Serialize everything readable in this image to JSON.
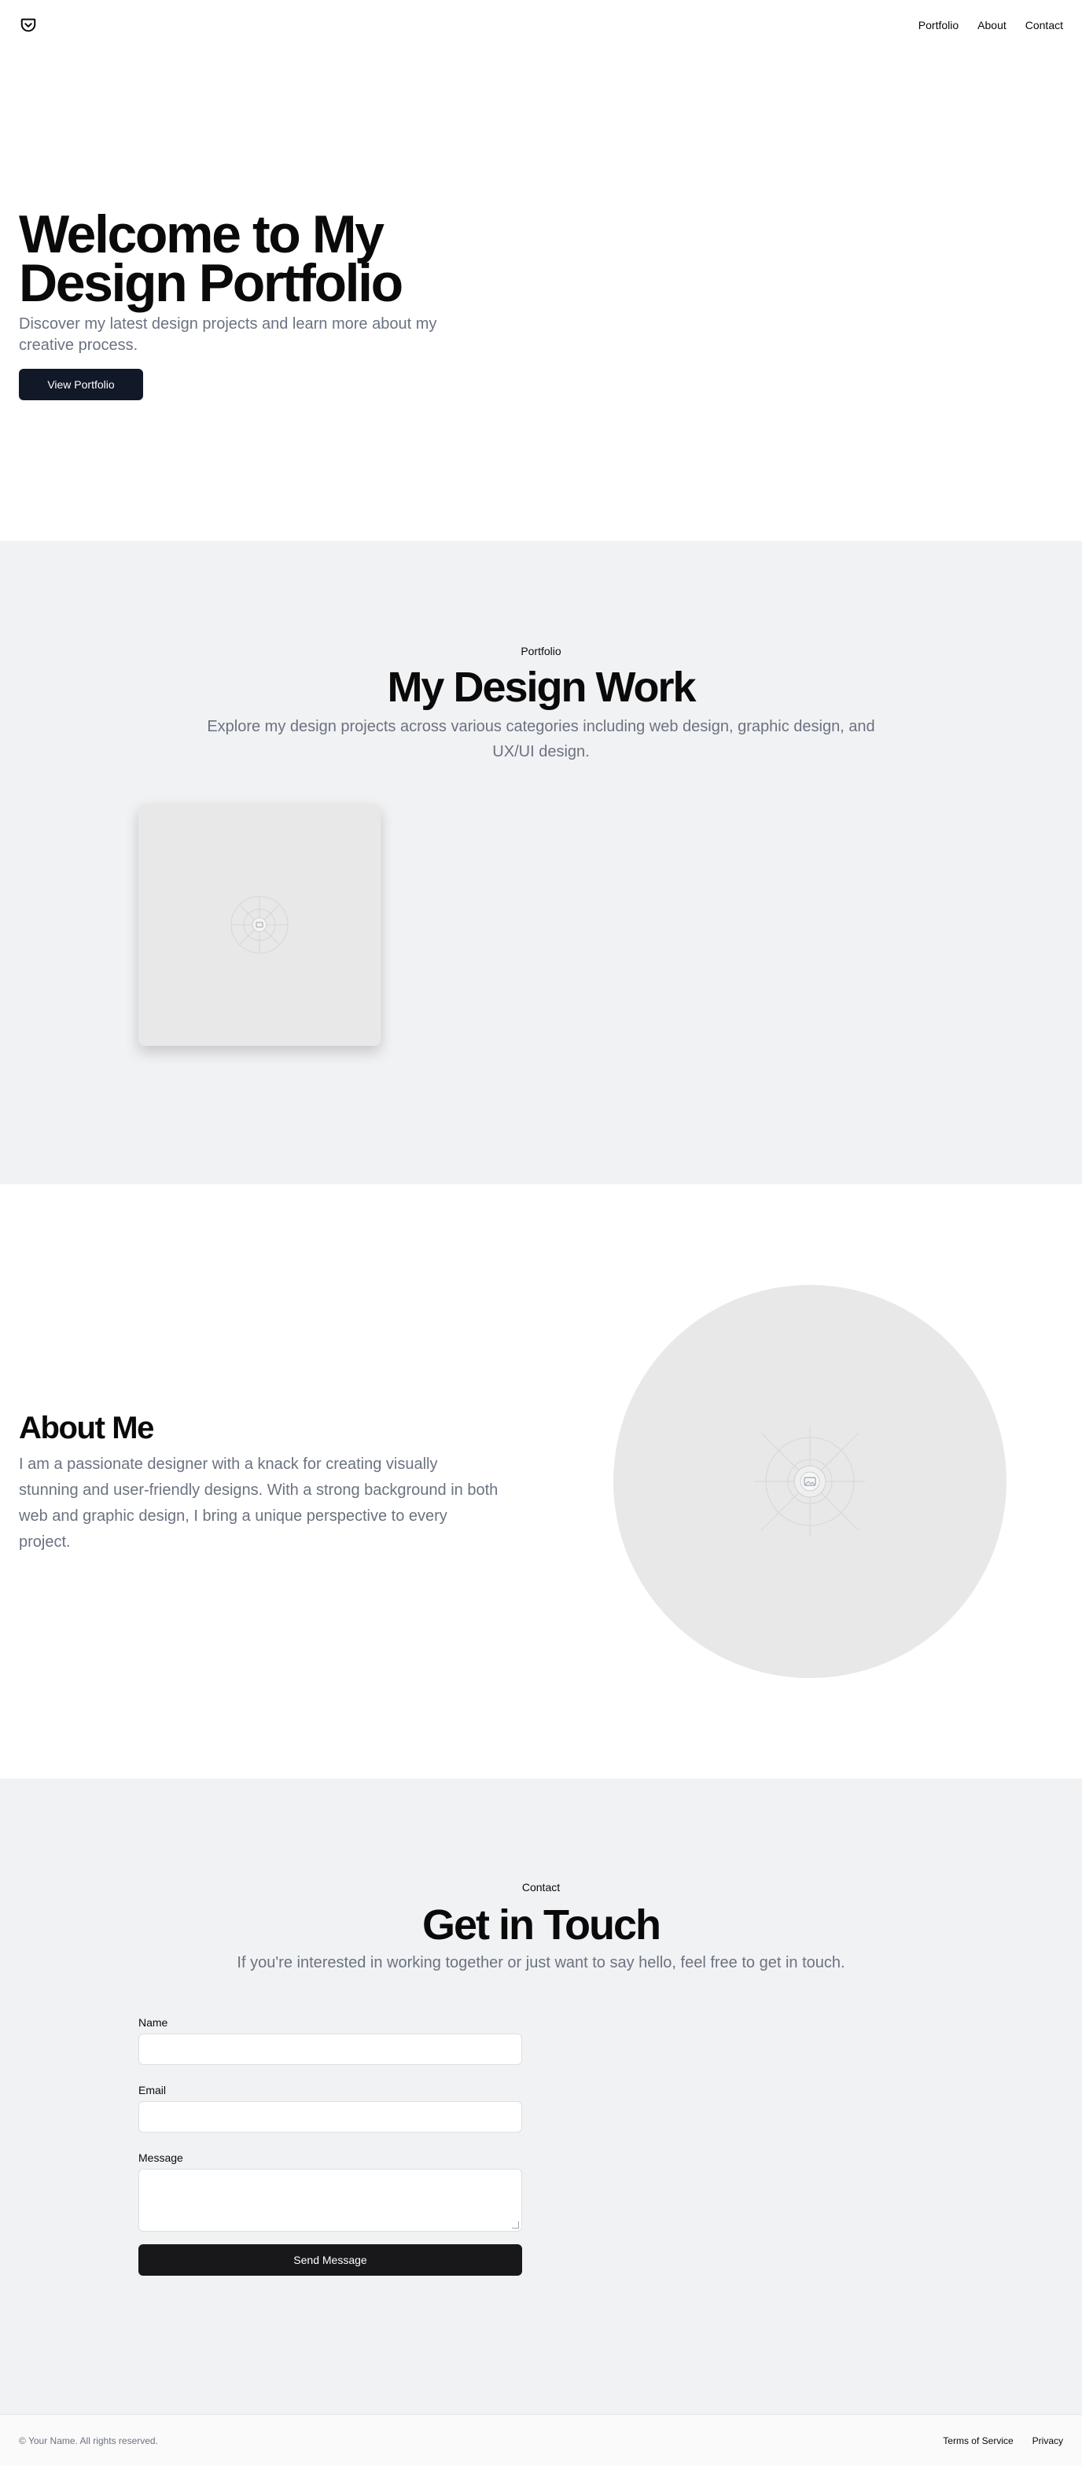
{
  "header": {
    "logo_icon": "pocket-shield-icon",
    "nav": [
      "Portfolio",
      "About",
      "Contact"
    ]
  },
  "hero": {
    "title": "Welcome to My Design Portfolio",
    "subtitle": "Discover my latest design projects and learn more about my creative process.",
    "cta": "View Portfolio"
  },
  "portfolio": {
    "eyebrow": "Portfolio",
    "title": "My Design Work",
    "subtitle": "Explore my design projects across various categories including web design, graphic design, and UX/UI design.",
    "card_icon": "image-placeholder-icon"
  },
  "about": {
    "title": "About Me",
    "body": "I am a passionate designer with a knack for creating visually stunning and user-friendly designs. With a strong background in both web and graphic design, I bring a unique perspective to every project.",
    "image_icon": "image-placeholder-icon"
  },
  "contact": {
    "eyebrow": "Contact",
    "title": "Get in Touch",
    "subtitle": "If you're interested in working together or just want to say hello, feel free to get in touch.",
    "name_label": "Name",
    "email_label": "Email",
    "message_label": "Message",
    "submit": "Send Message"
  },
  "footer": {
    "copyright": "© Your Name. All rights reserved.",
    "links": [
      "Terms of Service",
      "Privacy"
    ]
  },
  "colors": {
    "dark_button": "#111827",
    "muted_text": "#6b7280",
    "section_gray": "#f1f2f4"
  }
}
